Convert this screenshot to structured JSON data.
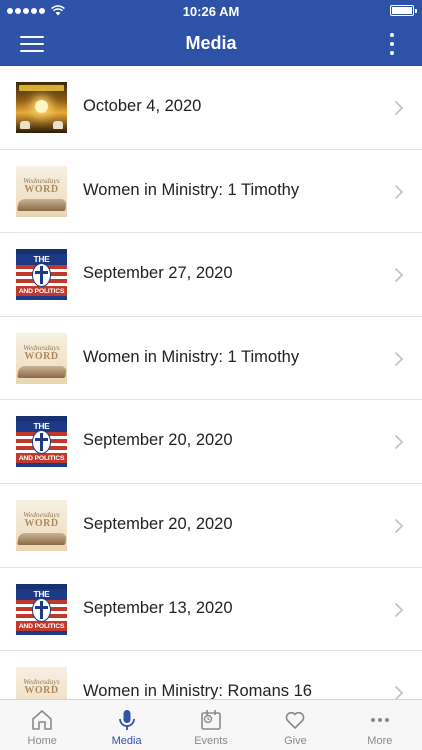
{
  "status_bar": {
    "time": "10:26 AM"
  },
  "header": {
    "title": "Media"
  },
  "media_list": [
    {
      "title": "October 4, 2020",
      "thumbnail": "sunrise-worship-artwork"
    },
    {
      "title": "Women in Ministry: 1 Timothy",
      "thumbnail": "wednesdays-word-artwork"
    },
    {
      "title": "September 27, 2020",
      "thumbnail": "church-and-politics-artwork"
    },
    {
      "title": "Women in Ministry: 1 Timothy",
      "thumbnail": "wednesdays-word-artwork"
    },
    {
      "title": "September 20, 2020",
      "thumbnail": "church-and-politics-artwork"
    },
    {
      "title": "September 20, 2020",
      "thumbnail": "wednesdays-word-artwork"
    },
    {
      "title": "September 13, 2020",
      "thumbnail": "church-and-politics-artwork"
    },
    {
      "title": "Women in Ministry: Romans 16",
      "thumbnail": "wednesdays-word-artwork"
    }
  ],
  "thumbnail_text": {
    "wednesdays_line1": "Wednesdays",
    "wednesdays_line2": "WORD",
    "church_line1": "THE CHURCH",
    "church_line2": "AND POLITICS"
  },
  "tab_bar": {
    "tabs": [
      {
        "label": "Home",
        "icon": "home-icon"
      },
      {
        "label": "Media",
        "icon": "microphone-icon",
        "active": true
      },
      {
        "label": "Events",
        "icon": "calendar-icon"
      },
      {
        "label": "Give",
        "icon": "heart-icon"
      },
      {
        "label": "More",
        "icon": "ellipsis-icon"
      }
    ]
  },
  "colors": {
    "brand": "#2f52a9",
    "tab_inactive": "#8a8a8a",
    "separator": "#e3e3e3"
  }
}
